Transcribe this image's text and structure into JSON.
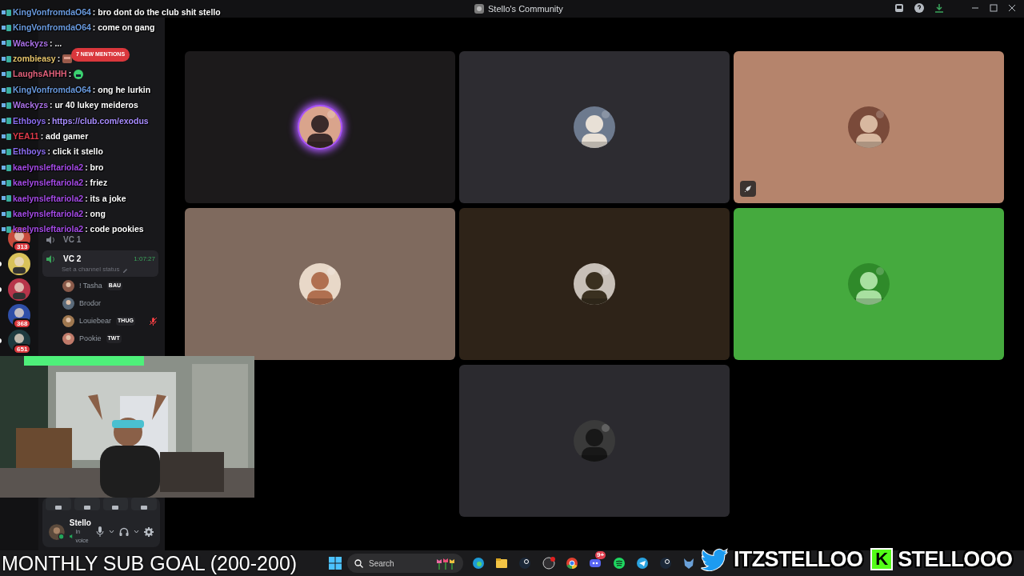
{
  "window": {
    "title": "Stello's Community"
  },
  "chat": [
    {
      "user": "KingVonfromdaO64",
      "color": "#6a9be0",
      "text": ": bro dont do the club shit stello"
    },
    {
      "user": "KingVonfromdaO64",
      "color": "#6a9be0",
      "text": ": come on gang"
    },
    {
      "user": "Wackyzs",
      "color": "#a970e6",
      "text": ": ..."
    },
    {
      "user": "zombieasy",
      "color": "#e6c56c",
      "text": ":",
      "kind": "emote"
    },
    {
      "user": "LaughsAHHH",
      "color": "#e0607a",
      "text": ":",
      "kind": "emote"
    },
    {
      "user": "KingVonfromdaO64",
      "color": "#6a9be0",
      "text": ": ong he lurkin"
    },
    {
      "user": "Wackyzs",
      "color": "#a970e6",
      "text": ": ur 40 lukey meideros"
    },
    {
      "user": "Ethboys",
      "color": "#8b6cf0",
      "text": ":",
      "link": "https://club.com/exodus"
    },
    {
      "user": "YEA11",
      "color": "#e03a4a",
      "text": ": add gamer"
    },
    {
      "user": "Ethboys",
      "color": "#8b6cf0",
      "text": ": click it stello"
    },
    {
      "user": "kaelynsleftariola2",
      "color": "#a64be8",
      "text": ": bro"
    },
    {
      "user": "kaelynsleftariola2",
      "color": "#a64be8",
      "text": ": friez"
    },
    {
      "user": "kaelynsleftariola2",
      "color": "#a64be8",
      "text": ": its a joke"
    },
    {
      "user": "kaelynsleftariola2",
      "color": "#a64be8",
      "text": ": ong"
    },
    {
      "user": "kaelynsleftariola2",
      "color": "#a64be8",
      "text": ": code pookies"
    }
  ],
  "mentions_pill": "7 NEW MENTIONS",
  "servers": [
    {
      "badge": "313",
      "unread": false
    },
    {
      "unread": true
    },
    {
      "unread": true
    },
    {
      "badge": "368",
      "unread": false
    },
    {
      "badge": "651",
      "unread": true
    }
  ],
  "voice_channels": [
    {
      "name": "VC 1",
      "selected": false
    },
    {
      "name": "VC 2",
      "selected": true,
      "timer": "1:07:27",
      "status_placeholder": "Set a channel status"
    }
  ],
  "members": [
    {
      "name": "! Tasha",
      "tag": "BAU",
      "muted": false
    },
    {
      "name": "Brodor",
      "muted": false
    },
    {
      "name": "Louiebear",
      "tag": "THUG",
      "muted": true
    },
    {
      "name": "Pookie",
      "tag": "TWT",
      "muted": false
    }
  ],
  "user_panel": {
    "name": "Stello",
    "status": "In voice"
  },
  "tiles": [
    {
      "color": "#1c1a1b",
      "speaking": true
    },
    {
      "color": "#2d2c31",
      "speaking": false
    },
    {
      "color": "#b5846c",
      "speaking": false,
      "activity": true
    },
    {
      "color": "#7f6a5e",
      "speaking": false
    },
    {
      "color": "#2e2318",
      "speaking": false
    },
    {
      "color": "#45aa3e",
      "speaking": false
    },
    {
      "color": "#2b2a2f",
      "speaking": false
    }
  ],
  "sub_goal": "MONTHLY SUB GOAL (200-200)",
  "taskbar": {
    "search_placeholder": "Search",
    "discord_badge": "9+"
  },
  "socials": [
    {
      "kind": "twitter",
      "handle": "ITZSTELLOO"
    },
    {
      "kind": "kick",
      "glyph": "K",
      "handle": "STELLOOO"
    }
  ]
}
